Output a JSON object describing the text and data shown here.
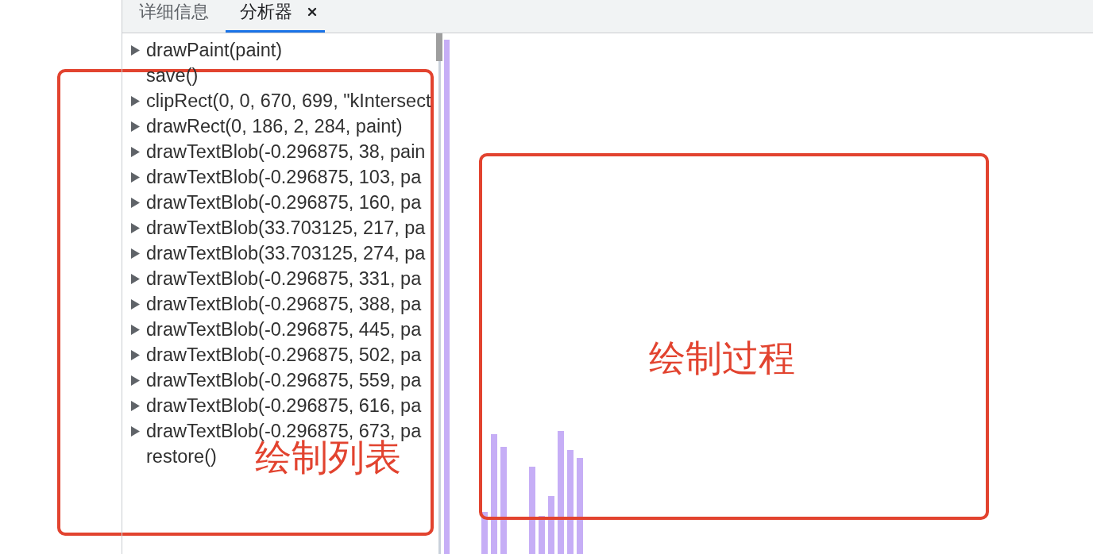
{
  "tabs": [
    {
      "label": "详细信息",
      "selected": false,
      "closable": false
    },
    {
      "label": "分析器",
      "selected": true,
      "closable": true
    }
  ],
  "command_list": {
    "items": [
      {
        "label": "drawPaint(paint)",
        "expandable": true
      },
      {
        "label": "save()",
        "expandable": false
      },
      {
        "label": "clipRect(0, 0, 670, 699, \"kIntersect",
        "expandable": true
      },
      {
        "label": "drawRect(0, 186, 2, 284, paint)",
        "expandable": true
      },
      {
        "label": "drawTextBlob(-0.296875, 38, pain",
        "expandable": true
      },
      {
        "label": "drawTextBlob(-0.296875, 103, pa",
        "expandable": true
      },
      {
        "label": "drawTextBlob(-0.296875, 160, pa",
        "expandable": true
      },
      {
        "label": "drawTextBlob(33.703125, 217, pa",
        "expandable": true
      },
      {
        "label": "drawTextBlob(33.703125, 274, pa",
        "expandable": true
      },
      {
        "label": "drawTextBlob(-0.296875, 331, pa",
        "expandable": true
      },
      {
        "label": "drawTextBlob(-0.296875, 388, pa",
        "expandable": true
      },
      {
        "label": "drawTextBlob(-0.296875, 445, pa",
        "expandable": true
      },
      {
        "label": "drawTextBlob(-0.296875, 502, pa",
        "expandable": true
      },
      {
        "label": "drawTextBlob(-0.296875, 559, pa",
        "expandable": true
      },
      {
        "label": "drawTextBlob(-0.296875, 616, pa",
        "expandable": true
      },
      {
        "label": "drawTextBlob(-0.296875, 673, pa",
        "expandable": true
      },
      {
        "label": "restore()",
        "expandable": false
      }
    ]
  },
  "annotations": [
    {
      "label": "绘制列表"
    },
    {
      "label": "绘制过程"
    }
  ]
}
